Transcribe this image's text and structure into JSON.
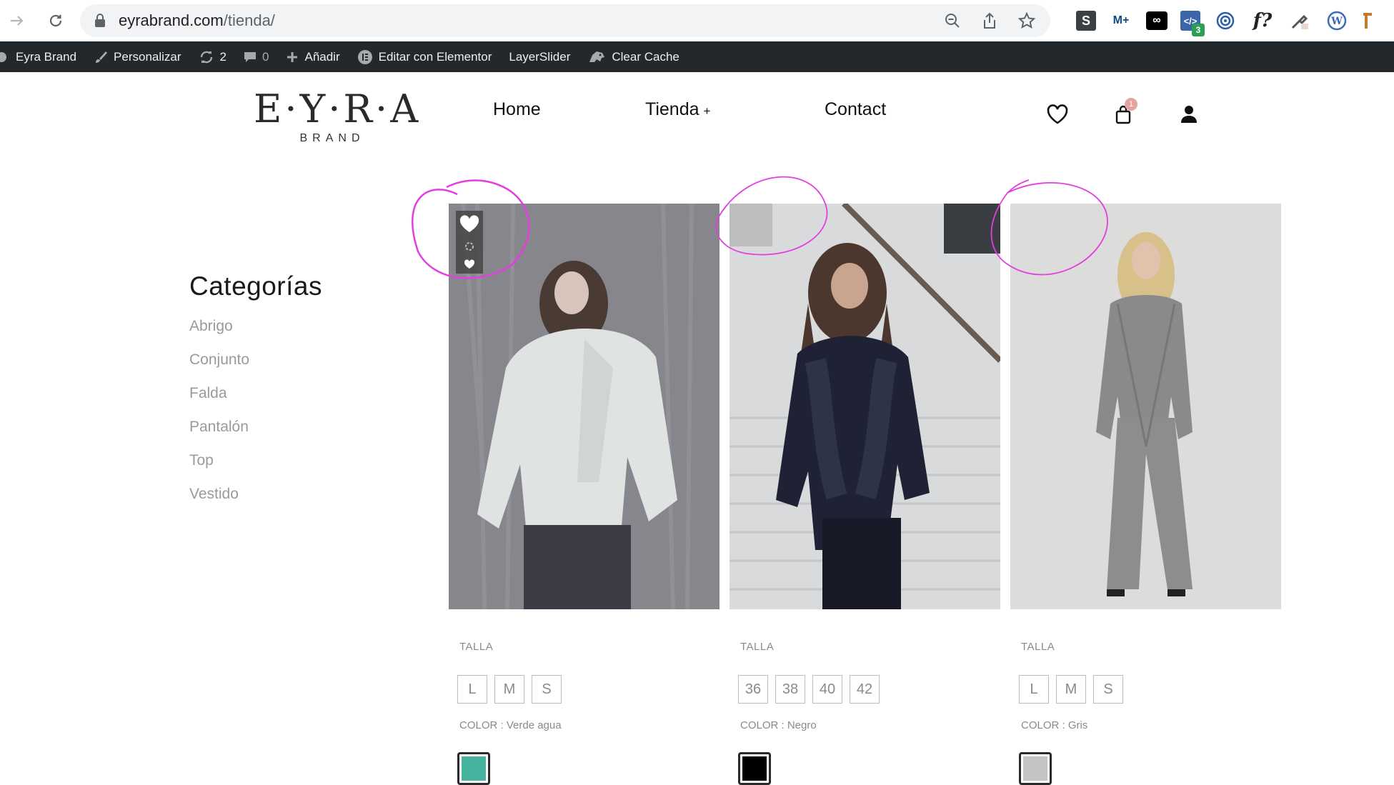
{
  "browser": {
    "url_host": "eyrabrand.com",
    "url_path": "/tienda/"
  },
  "admin_bar": {
    "site_name": "Eyra Brand",
    "customize": "Personalizar",
    "updates_count": "2",
    "comments_count": "0",
    "add_new": "Añadir",
    "edit_elementor": "Editar con Elementor",
    "layerslider": "LayerSlider",
    "clear_cache": "Clear Cache"
  },
  "header": {
    "logo_main": "E·Y·R·A",
    "logo_sub": "BRAND",
    "menu": {
      "home": "Home",
      "shop": "Tienda",
      "shop_plus": "+",
      "contact": "Contact"
    },
    "cart_count": "1"
  },
  "sidebar": {
    "title": "Categorías",
    "categories": [
      "Abrigo",
      "Conjunto",
      "Falda",
      "Pantalón",
      "Top",
      "Vestido"
    ]
  },
  "products": [
    {
      "size_label": "TALLA",
      "sizes": [
        "L",
        "M",
        "S"
      ],
      "color_label": "COLOR : Verde agua",
      "swatch_color": "#45b39d"
    },
    {
      "size_label": "TALLA",
      "sizes": [
        "36",
        "38",
        "40",
        "42"
      ],
      "color_label": "COLOR : Negro",
      "swatch_color": "#000000"
    },
    {
      "size_label": "TALLA",
      "sizes": [
        "L",
        "M",
        "S"
      ],
      "color_label": "COLOR : Gris",
      "swatch_color": "#c4c4c4"
    }
  ],
  "colors": {
    "admin_bar_bg": "#23282d",
    "annotation": "#e23ee0"
  }
}
